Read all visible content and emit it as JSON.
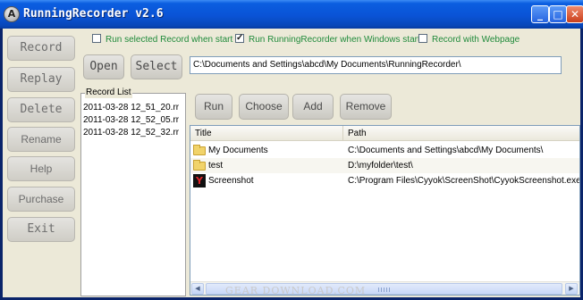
{
  "window": {
    "title": "RunningRecorder v2.6",
    "icon_letter": "A",
    "controls": {
      "minimize": "_",
      "maximize": "□",
      "close": "✕"
    }
  },
  "sidebar": {
    "buttons": [
      {
        "label": "Record"
      },
      {
        "label": "Replay"
      },
      {
        "label": "Delete"
      },
      {
        "label": "Rename"
      },
      {
        "label": "Help"
      },
      {
        "label": "Purchase"
      },
      {
        "label": "Exit"
      }
    ]
  },
  "options": {
    "run_selected": {
      "label": "Run selected Record when start",
      "checked": false
    },
    "run_on_windows_start": {
      "label": "Run RunningRecorder when Windows start",
      "checked": true
    },
    "record_with_webpage": {
      "label": "Record with Webpage",
      "checked": false
    }
  },
  "toolbar": {
    "open_label": "Open",
    "select_label": "Select",
    "path_value": "C:\\Documents and Settings\\abcd\\My Documents\\RunningRecorder\\"
  },
  "record_list": {
    "title": "Record List",
    "items": [
      "2011-03-28 12_51_20.rr",
      "2011-03-28 12_52_05.rr",
      "2011-03-28 12_52_32.rr"
    ]
  },
  "actions": {
    "run_label": "Run",
    "choose_label": "Choose",
    "add_label": "Add",
    "remove_label": "Remove"
  },
  "file_list": {
    "columns": [
      "Title",
      "Path"
    ],
    "rows": [
      {
        "icon": "folder-icon",
        "title": "My Documents",
        "path": "C:\\Documents and Settings\\abcd\\My Documents\\"
      },
      {
        "icon": "folder-icon",
        "title": "test",
        "path": "D:\\myfolder\\test\\"
      },
      {
        "icon": "screenshot-app-icon",
        "title": "Screenshot",
        "path": "C:\\Program Files\\Cyyok\\ScreenShot\\CyyokScreenshot.exe"
      }
    ]
  },
  "watermark": "GEAR DOWNLOAD.COM"
}
